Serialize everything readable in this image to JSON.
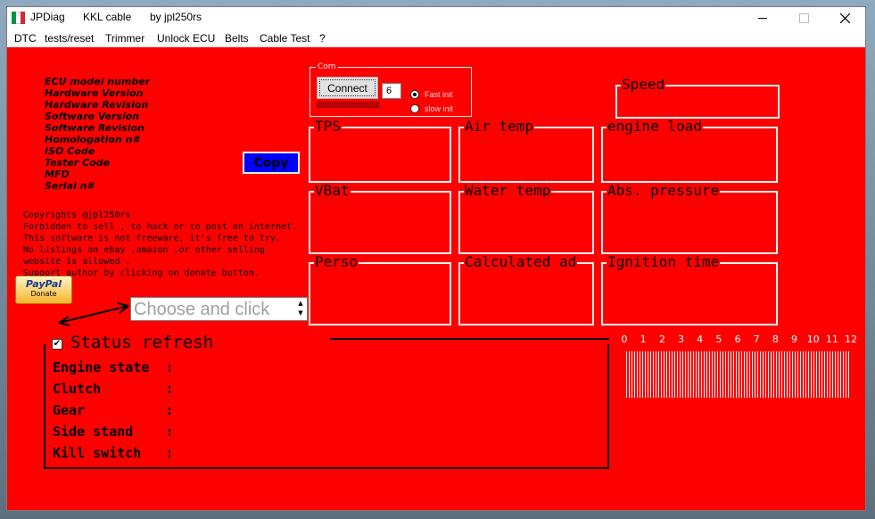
{
  "titlebar": {
    "app": "JPDiag",
    "cable": "KKL cable",
    "author": "by jpl250rs",
    "flag_colors": [
      "#009246",
      "#ffffff",
      "#ce2b37"
    ]
  },
  "menu": [
    "DTC",
    "tests/reset",
    "Trimmer",
    "Unlock ECU",
    "Belts",
    "Cable Test",
    "?"
  ],
  "ecu_labels": [
    "ECU model number",
    "Hardware Version",
    "Hardware Revision",
    "Software Version",
    "Software Revision",
    "Homologation n#",
    "ISO Code",
    "Tester Code",
    "MFD",
    "Serial n#"
  ],
  "copy_label": "Copy",
  "notice": [
    "Copyrights @jpl250rs",
    "Forbidden to sell , to hack or to post on internet.",
    "This software is not freeware, it's free to try.",
    "No listings on ebay ,amazon ,or other selling",
    "website is allowed .",
    "Support author by clicking on donate button."
  ],
  "paypal": {
    "logo": "PayPal",
    "donate": "Donate"
  },
  "device_select": {
    "value": "Choose and click"
  },
  "com": {
    "legend": "Com",
    "connect": "Connect",
    "port": "6",
    "fast_init": "Fast init",
    "slow_init": "slow init",
    "selected": "fast"
  },
  "gauges": {
    "speed": "Speed",
    "tps": "TPS",
    "air_temp": "Air temp",
    "engine_load": "engine load",
    "vbat": "VBat",
    "water_temp": "Water temp",
    "abs_pressure": "Abs. pressure",
    "perso": "Perso",
    "calculated_ad": "Calculated ad",
    "ignition_time": "Ignition time"
  },
  "status": {
    "refresh_label": "Status refresh",
    "refresh_checked": true,
    "rows": [
      "Engine state  :",
      "Clutch        :",
      "Gear          :",
      "Side stand    :",
      "Kill switch   :"
    ]
  },
  "rpm": {
    "labels": [
      "0",
      "1",
      "2",
      "3",
      "4",
      "5",
      "6",
      "7",
      "8",
      "9",
      "10",
      "11",
      "12"
    ]
  },
  "colors": {
    "client_bg": "#ff0000",
    "copy_button": "#0000ff",
    "connect_progress": "#c00000"
  }
}
